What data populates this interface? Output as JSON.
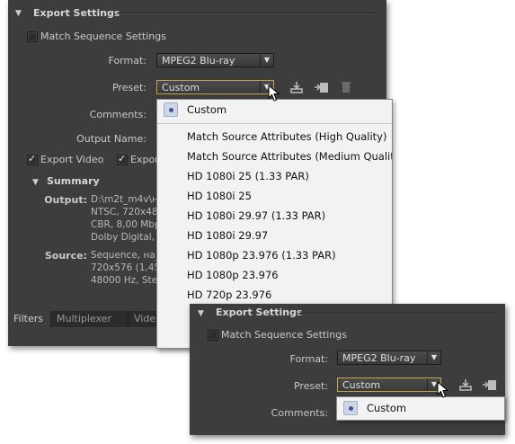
{
  "back": {
    "section_title": "Export Settings",
    "match_sequence": "Match Sequence Settings",
    "format_label": "Format:",
    "format_value": "MPEG2 Blu-ray",
    "preset_label": "Preset:",
    "preset_value": "Custom",
    "comments_label": "Comments:",
    "output_name_label": "Output Name:",
    "export_video": "Export Video",
    "export_audio_partial": "Expor",
    "summary_title": "Summary",
    "output_label": "Output:",
    "output_lines": [
      "D:\\m2t_m4v\\н",
      "NTSC, 720x480",
      "CBR, 8,00 Mbp",
      "Dolby Digital,"
    ],
    "source_label": "Source:",
    "source_lines": [
      "Sequence, на_",
      "720x576 (1,458",
      "48000 Hz, Ster"
    ],
    "tabs": [
      "Filters",
      "Multiplexer",
      "Vide"
    ]
  },
  "menu": {
    "items": [
      "Custom",
      "Match Source Attributes (High Quality)",
      "Match Source Attributes (Medium Quality)",
      "HD 1080i 25 (1.33 PAR)",
      "HD 1080i 25",
      "HD 1080i 29.97 (1.33 PAR)",
      "HD 1080i 29.97",
      "HD 1080p 23.976 (1.33 PAR)",
      "HD 1080p 23.976",
      "HD 720p 23.976"
    ],
    "selected": "Custom"
  },
  "front": {
    "section_title": "Export Settings",
    "match_sequence": "Match Sequence Settings",
    "format_label": "Format:",
    "format_value": "MPEG2 Blu-ray",
    "preset_label": "Preset:",
    "preset_value": "Custom",
    "comments_label": "Comments:",
    "menu_item": "Custom"
  },
  "icons": {
    "save_preset": "save-preset-icon",
    "import_preset": "import-preset-icon",
    "delete_preset": "delete-preset-icon",
    "cursor": "mouse-cursor-icon"
  },
  "colors": {
    "panel_bg": "#3d3d3d",
    "focus_border": "#c7a04a",
    "menu_bg": "#f2f2f2",
    "selected_dot": "#3a55a0"
  }
}
